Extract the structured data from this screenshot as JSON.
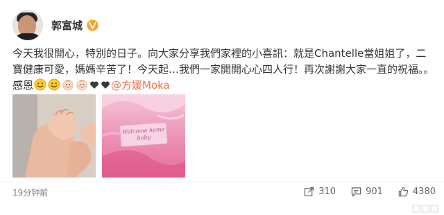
{
  "post": {
    "author": {
      "name": "郭富城",
      "verified": true,
      "verified_badge_color": "#f5a623",
      "avatar_icon": "avatar-photo"
    },
    "content": {
      "text": "今天我很開心，特別的日子。向大家分享我們家裡的小喜訊：就是Chantelle當姐姐了，二寶健康可愛，媽媽辛苦了！今天起…我們一家開開心心四人行！再次謝謝大家一直的祝福。。感恩",
      "emojis": [
        "smile-emoji",
        "smile-emoji",
        "baby-emoji",
        "baby-emoji",
        "heart-icon",
        "heart-icon"
      ],
      "mention": "@方媛Moka",
      "mention_color": "#eb7350"
    },
    "photos": [
      {
        "name": "baby-hands-photo"
      },
      {
        "name": "welcome-home-photo",
        "sign_line1": "Welcome home",
        "sign_line2": "baby"
      }
    ],
    "timestamp": "19分钟前",
    "stats": {
      "reposts": "310",
      "comments": "901",
      "likes": "4380"
    }
  }
}
